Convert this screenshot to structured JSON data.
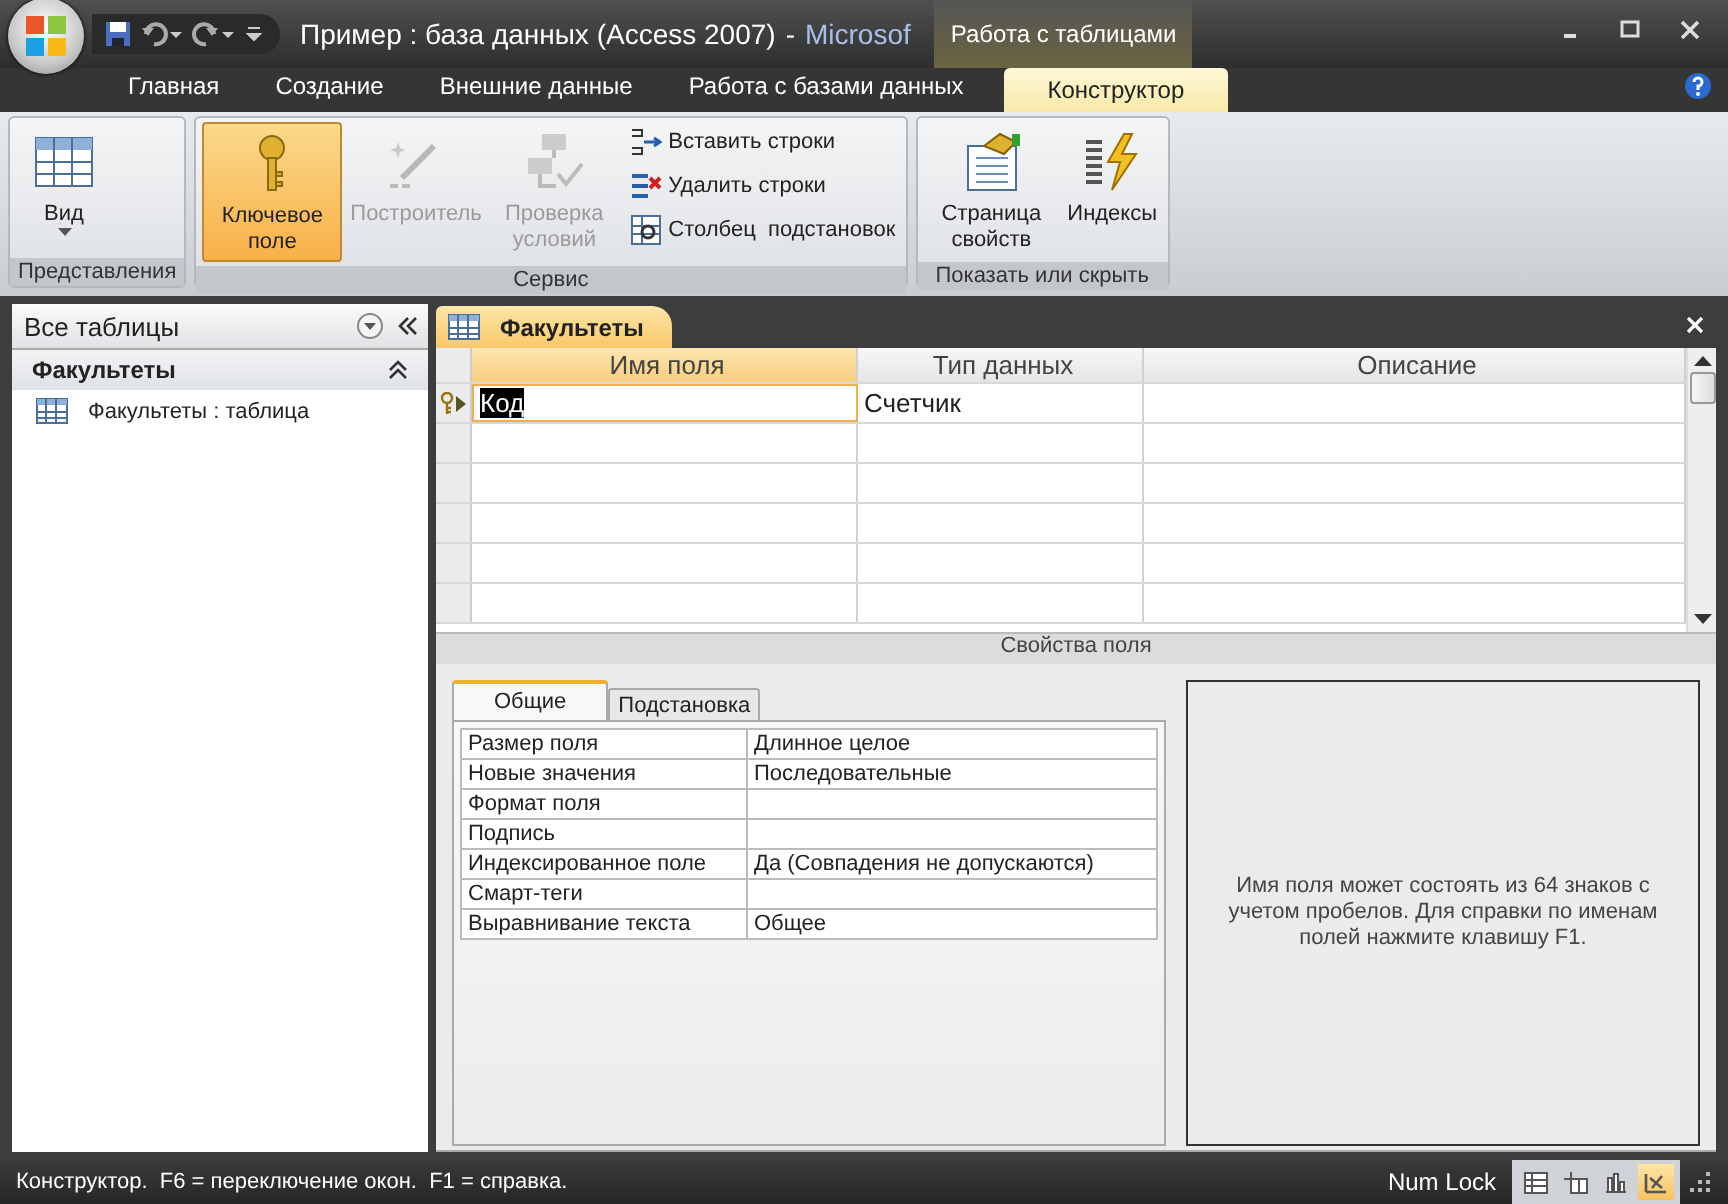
{
  "window": {
    "title": "Пример : база данных (Access 2007)",
    "separator": "-",
    "app_name": "Microsof"
  },
  "context_tab_group": "Работа с таблицами",
  "ribbon_tabs": [
    {
      "label": "Главная",
      "selected": false
    },
    {
      "label": "Создание",
      "selected": false
    },
    {
      "label": "Внешние данные",
      "selected": false
    },
    {
      "label": "Работа с базами данных",
      "selected": false
    },
    {
      "label": "Конструктор",
      "selected": true
    }
  ],
  "ribbon_groups": [
    {
      "label": "Представления",
      "buttons": [
        {
          "kind": "large",
          "label": "Вид",
          "disabled": false,
          "selected": false
        }
      ]
    },
    {
      "label": "Сервис",
      "buttons": [
        {
          "kind": "large",
          "label": "Ключевое поле",
          "disabled": false,
          "selected": true
        },
        {
          "kind": "large",
          "label": "Построитель",
          "disabled": true,
          "selected": false
        },
        {
          "kind": "large",
          "label": "Проверка условий",
          "disabled": true,
          "selected": false
        },
        {
          "kind": "small",
          "label": "Вставить строки",
          "disabled": false,
          "selected": false
        },
        {
          "kind": "small",
          "label": "Удалить строки",
          "disabled": false,
          "selected": false
        },
        {
          "kind": "small",
          "label": "Столбец  подстановок",
          "disabled": false,
          "selected": false
        }
      ]
    },
    {
      "label": "Показать или скрыть",
      "buttons": [
        {
          "kind": "large",
          "label": "Страница свойств",
          "disabled": false,
          "selected": false
        },
        {
          "kind": "large",
          "label": "Индексы",
          "disabled": false,
          "selected": false
        }
      ]
    }
  ],
  "nav_pane": {
    "title": "Все таблицы",
    "group": "Факультеты",
    "items": [
      {
        "label": "Факультеты : таблица"
      }
    ]
  },
  "document_tab": "Факультеты",
  "design_grid": {
    "columns": [
      "Имя поля",
      "Тип данных",
      "Описание"
    ],
    "rows": [
      {
        "field_name": "Код",
        "data_type": "Счетчик",
        "primary_key": true,
        "selected": true
      }
    ]
  },
  "field_properties": {
    "title": "Свойства поля",
    "tabs": [
      {
        "label": "Общие",
        "selected": true
      },
      {
        "label": "Подстановка",
        "selected": false
      }
    ],
    "properties": [
      {
        "name": "Размер поля",
        "value": "Длинное целое"
      },
      {
        "name": "Новые значения",
        "value": "Последовательные"
      },
      {
        "name": "Формат поля"
      },
      {
        "name": "Подпись"
      },
      {
        "name": "Индексированное поле",
        "value": "Да (Совпадения не допускаются)"
      },
      {
        "name": "Смарт-теги"
      },
      {
        "name": "Выравнивание текста",
        "value": "Общее"
      }
    ],
    "help_text": "Имя поля может состоять из 64 знаков с учетом пробелов.  Для справки по именам полей нажмите клавишу F1."
  },
  "status_bar": {
    "text": "Конструктор.  F6 = переключение окон.  F1 = справка.",
    "num_lock": "Num Lock",
    "views": [
      {
        "selected": false
      },
      {
        "selected": false
      },
      {
        "selected": false
      },
      {
        "selected": true
      }
    ]
  }
}
